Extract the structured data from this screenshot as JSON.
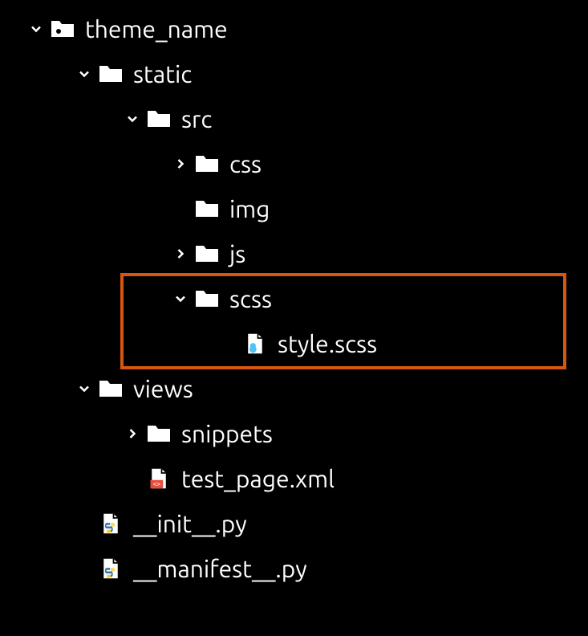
{
  "tree": {
    "theme_name": "theme_name",
    "static": "static",
    "src": "src",
    "css": "css",
    "img": "img",
    "js": "js",
    "scss": "scss",
    "style_scss": "style.scss",
    "views": "views",
    "snippets": "snippets",
    "test_page_xml": "test_page.xml",
    "init_py": "__init__.py",
    "manifest_py": "__manifest__.py"
  }
}
